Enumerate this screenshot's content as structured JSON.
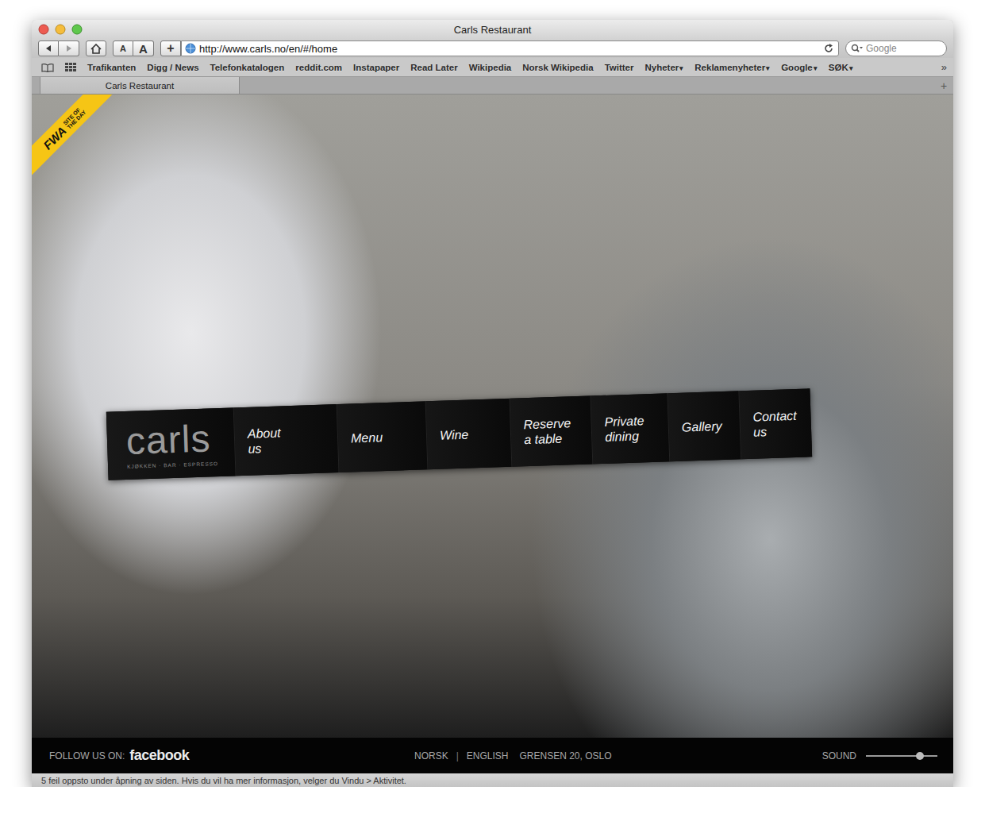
{
  "window": {
    "title": "Carls Restaurant"
  },
  "toolbar": {
    "font_buttons": [
      "A",
      "A"
    ],
    "add_bookmark": "+",
    "url": "http://www.carls.no/en/#/home",
    "search": {
      "placeholder": "Google"
    }
  },
  "bookmarks": {
    "items": [
      {
        "label": "Trafikanten",
        "caret": ""
      },
      {
        "label": "Digg / News",
        "caret": ""
      },
      {
        "label": "Telefonkatalogen",
        "caret": ""
      },
      {
        "label": "reddit.com",
        "caret": ""
      },
      {
        "label": "Instapaper",
        "caret": ""
      },
      {
        "label": "Read Later",
        "caret": ""
      },
      {
        "label": "Wikipedia",
        "caret": ""
      },
      {
        "label": "Norsk Wikipedia",
        "caret": ""
      },
      {
        "label": "Twitter",
        "caret": ""
      },
      {
        "label": "Nyheter",
        "caret": "▾"
      },
      {
        "label": "Reklamenyheter",
        "caret": "▾"
      },
      {
        "label": "Google",
        "caret": "▾"
      },
      {
        "label": "SØK",
        "caret": "▾"
      }
    ],
    "overflow": "»"
  },
  "tabs": [
    {
      "label": "Carls Restaurant",
      "selected": true
    }
  ],
  "new_tab": "+",
  "badge": {
    "logo": "FWA",
    "text": "SITE OF THE DAY"
  },
  "nav": {
    "logo": "carls",
    "tagline": "KJØKKEN · BAR · ESPRESSO",
    "items": [
      {
        "lines": [
          "About",
          "us"
        ]
      },
      {
        "lines": [
          "Menu"
        ]
      },
      {
        "lines": [
          "Wine"
        ]
      },
      {
        "lines": [
          "Reserve",
          "a table"
        ]
      },
      {
        "lines": [
          "Private",
          "dining"
        ]
      },
      {
        "lines": [
          "Gallery"
        ]
      },
      {
        "lines": [
          "Contact",
          "us"
        ]
      }
    ]
  },
  "footer": {
    "follow": "FOLLOW US ON:",
    "facebook": "facebook",
    "languages": [
      "NORSK",
      "ENGLISH"
    ],
    "separator": "|",
    "address": "GRENSEN 20, OSLO",
    "sound": {
      "label": "SOUND",
      "level": 0.76
    }
  },
  "status_bar": "5 feil oppsto under åpning av siden. Hvis du vil ha mer informasjon, velger du Vindu > Aktivitet."
}
